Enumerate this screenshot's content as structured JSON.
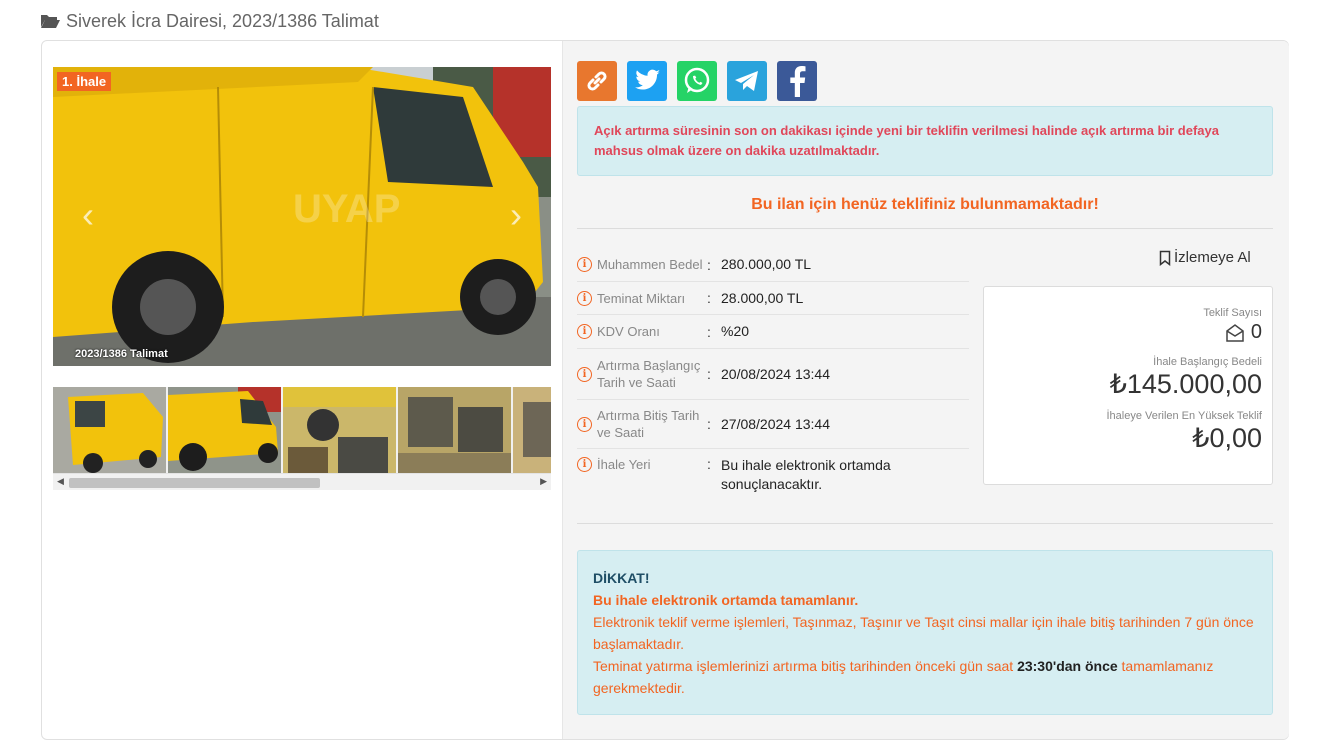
{
  "page": {
    "title": "Siverek İcra Dairesi, 2023/1386 Talimat"
  },
  "gallery": {
    "badge": "1. İhale",
    "photo_caption": "2023/1386  Talimat",
    "thumbnail_count": 5
  },
  "share": {
    "buttons": [
      {
        "name": "link",
        "color": "#e8772e"
      },
      {
        "name": "twitter",
        "color": "#1da1f2"
      },
      {
        "name": "whatsapp",
        "color": "#25d366"
      },
      {
        "name": "telegram",
        "color": "#2aa3dc"
      },
      {
        "name": "facebook",
        "color": "#3b5998"
      }
    ]
  },
  "notice": {
    "extension": "Açık artırma süresinin son on dakikası içinde yeni bir teklifin verilmesi halinde açık artırma bir defaya mahsus olmak üzere on dakika uzatılmaktadır.",
    "no_offer": "Bu ilan için henüz teklifiniz bulunmamaktadır!"
  },
  "info": {
    "rows": [
      {
        "label": "Muhammen Bedel",
        "value": "280.000,00 TL"
      },
      {
        "label": "Teminat Miktarı",
        "value": "28.000,00 TL"
      },
      {
        "label": "KDV Oranı",
        "value": "%20"
      },
      {
        "label": "Artırma Başlangıç Tarih ve Saati",
        "value": "20/08/2024 13:44"
      },
      {
        "label": "Artırma Bitiş Tarih ve Saati",
        "value": "27/08/2024 13:44"
      },
      {
        "label": "İhale Yeri",
        "value": "Bu ihale elektronik ortamda sonuçlanacaktır."
      }
    ]
  },
  "watch": {
    "label": "İzlemeye Al"
  },
  "stats": {
    "offer_count_label": "Teklif Sayısı",
    "offer_count": "0",
    "start_price_label": "İhale Başlangıç Bedeli",
    "start_price": "₺145.000,00",
    "highest_label": "İhaleye Verilen En Yüksek Teklif",
    "highest": "₺0,00"
  },
  "warning": {
    "heading": "DİKKAT!",
    "bold_line": "Bu ihale elektronik ortamda tamamlanır.",
    "line1": "Elektronik teklif verme işlemleri, Taşınmaz, Taşınır ve Taşıt cinsi mallar için ihale bitiş tarihinden 7 gün önce başlamaktadır.",
    "line2_pre": "Teminat yatırma işlemlerinizi artırma bitiş tarihinden önceki gün saat ",
    "line2_bold": "23:30'dan önce",
    "line2_post": " tamamlamanız gerekmektedir."
  },
  "colors": {
    "accent": "#f26522",
    "alert_bg": "#d6eef2",
    "alert_red": "#e0475a",
    "heading_dark": "#1f4e66"
  }
}
